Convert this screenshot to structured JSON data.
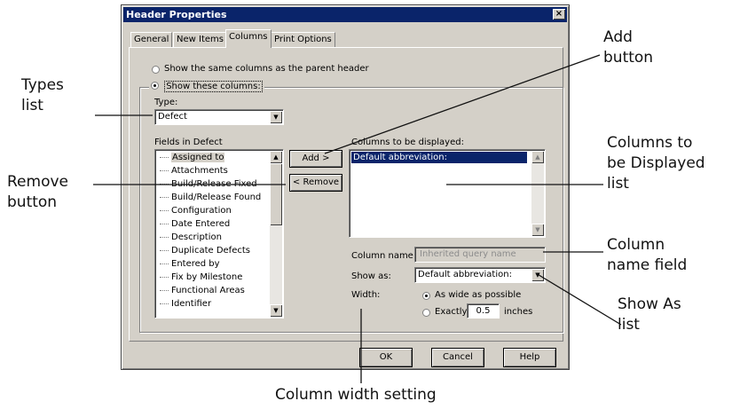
{
  "dialog": {
    "title": "Header Properties",
    "close_glyph": "×",
    "tabs": [
      "General",
      "New Items",
      "Columns",
      "Print Options"
    ],
    "active_tab": "Columns"
  },
  "columns_tab": {
    "radio_parent": "Show the same columns as the parent header",
    "radio_these": "Show these columns:",
    "type_label": "Type:",
    "type_value": "Defect",
    "fields_label": "Fields in Defect",
    "fields": [
      "Assigned to",
      "Attachments",
      "Build/Release Fixed",
      "Build/Release Found",
      "Configuration",
      "Date Entered",
      "Description",
      "Duplicate Defects",
      "Entered by",
      "Fix by Milestone",
      "Functional Areas",
      "Identifier"
    ],
    "add_button": "Add >",
    "remove_button": "< Remove",
    "columns_label": "Columns to be displayed:",
    "columns_items": [
      "Default abbreviation:"
    ],
    "column_name_label": "Column name:",
    "column_name_placeholder": "Inherited query name",
    "show_as_label": "Show as:",
    "show_as_value": "Default abbreviation:",
    "width_label": "Width:",
    "width_wide": "As wide as possible",
    "width_exactly": "Exactly",
    "width_value": "0.5",
    "width_units": "inches"
  },
  "footer": {
    "ok": "OK",
    "cancel": "Cancel",
    "help": "Help"
  },
  "callouts": {
    "types_list": [
      "Types",
      "list"
    ],
    "remove_button": [
      "Remove",
      "button"
    ],
    "add_button": [
      "Add",
      "button"
    ],
    "columns_displayed": [
      "Columns to",
      "be Displayed",
      "list"
    ],
    "column_name": [
      "Column",
      "name field"
    ],
    "show_as": [
      "Show As",
      "list"
    ],
    "column_width": "Column width setting"
  }
}
